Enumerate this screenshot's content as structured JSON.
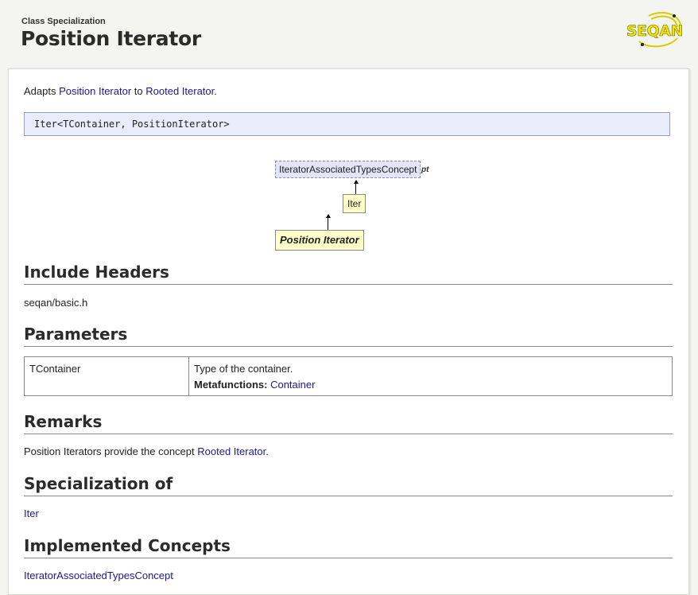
{
  "header": {
    "kind": "Class Specialization",
    "title": "Position Iterator",
    "logo_text": "SEQAN"
  },
  "intro": {
    "prefix": "Adapts",
    "link1": "Position Iterator",
    "middle": "to",
    "link2": "Rooted Iterator",
    "suffix": "."
  },
  "signature": "Iter<TContainer, PositionIterator>",
  "diagram": {
    "concept_node": "IteratorAssociatedTypesConcept",
    "concept_suffix": "pt",
    "parent_node": "Iter",
    "main_node": "Position Iterator"
  },
  "sections": {
    "include_headers": {
      "heading": "Include Headers",
      "value": "seqan/basic.h"
    },
    "parameters": {
      "heading": "Parameters",
      "rows": [
        {
          "name": "TContainer",
          "description": "Type of the container.",
          "metafunctions_label": "Metafunctions:",
          "metafunctions_link": "Container"
        }
      ]
    },
    "remarks": {
      "heading": "Remarks",
      "text": "Position Iterators provide the concept",
      "link": "Rooted Iterator",
      "suffix": "."
    },
    "specialization_of": {
      "heading": "Specialization of",
      "link": "Iter"
    },
    "implemented_concepts": {
      "heading": "Implemented Concepts",
      "link": "IteratorAssociatedTypesConcept"
    }
  },
  "colors": {
    "link": "#1a1a8c",
    "signature_bg": "#e8ecfb",
    "node_yellow": "#fefec8",
    "node_concept": "#e4e4f6",
    "logo_yellow": "#f2e600"
  }
}
